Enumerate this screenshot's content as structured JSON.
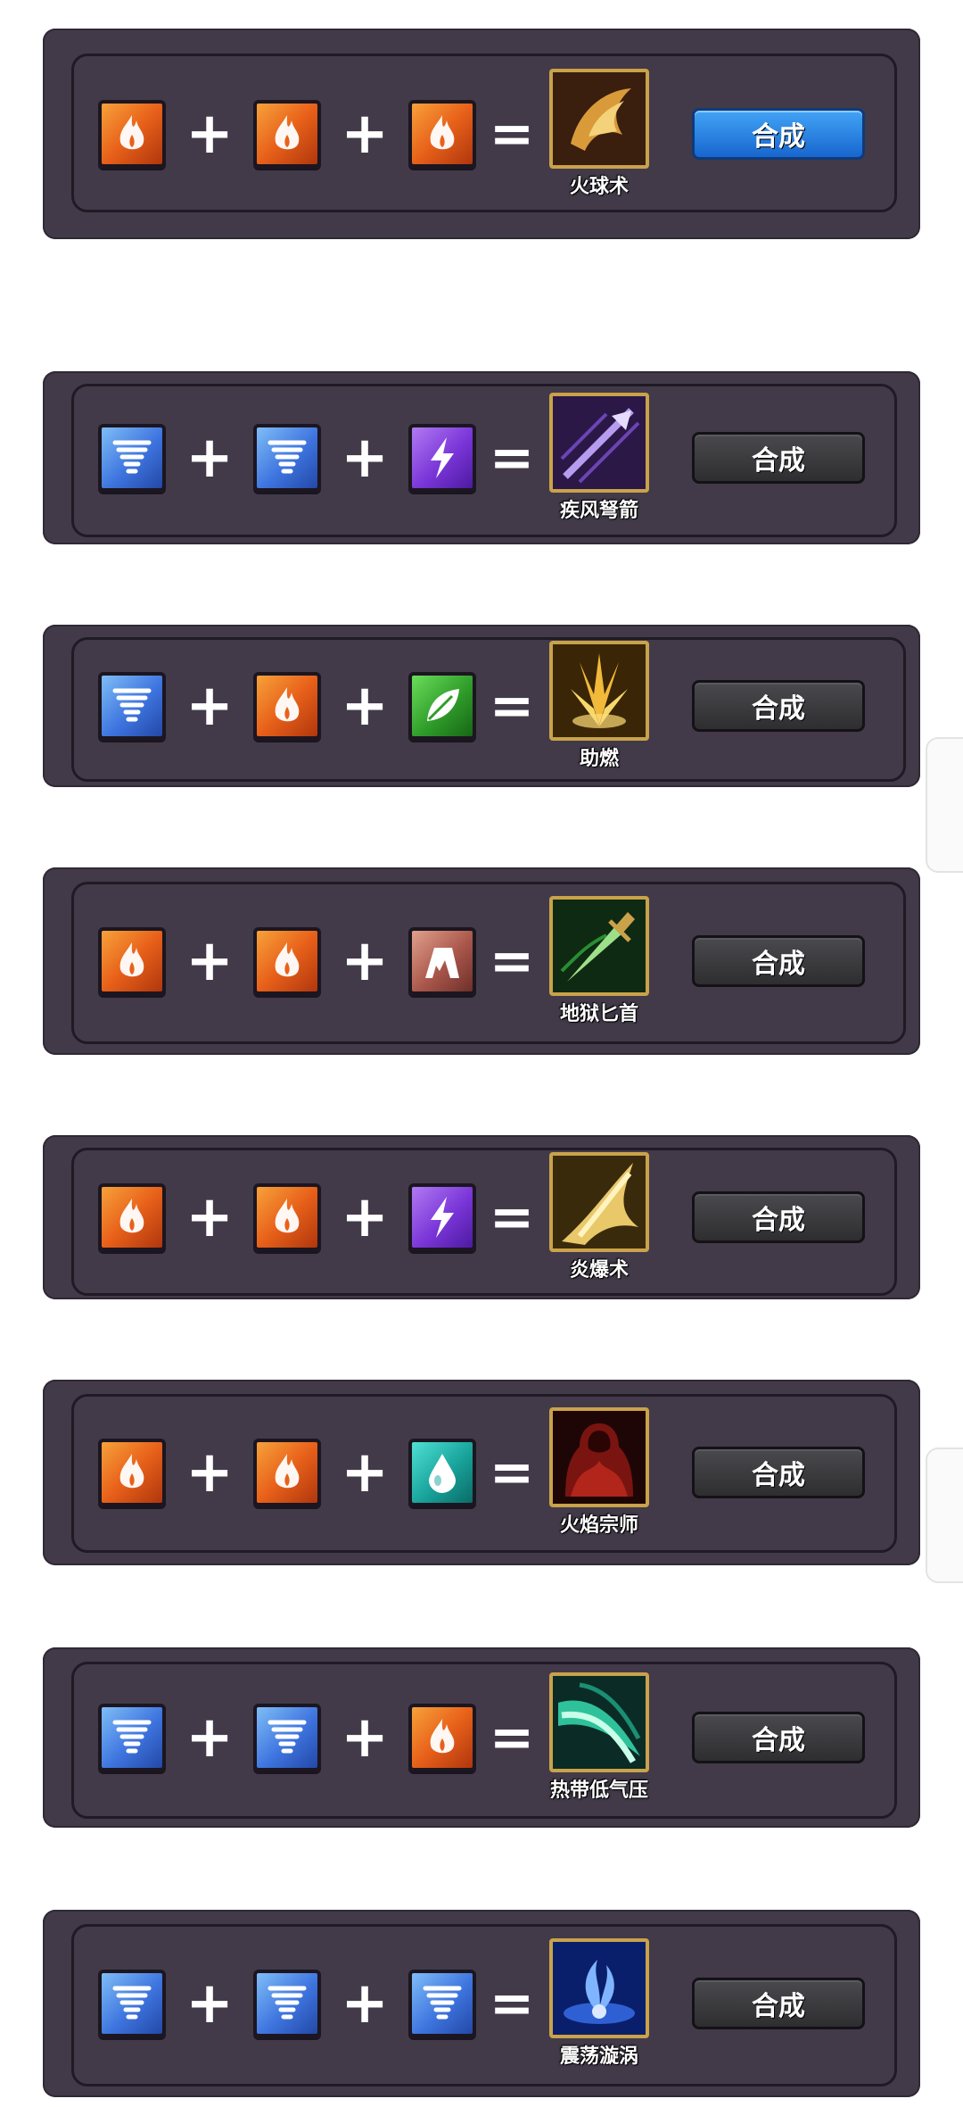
{
  "recipes": [
    {
      "ingredients": [
        "fire",
        "fire",
        "fire"
      ],
      "plus": "+",
      "equals": "=",
      "skill_name": "火球术",
      "skill_icon": "fireball-icon",
      "button_label": "合成",
      "button_active": true
    },
    {
      "ingredients": [
        "wind",
        "wind",
        "thunder"
      ],
      "plus": "+",
      "equals": "=",
      "skill_name": "疾风弩箭",
      "skill_icon": "gale-arrow-icon",
      "button_label": "合成",
      "button_active": false
    },
    {
      "ingredients": [
        "wind",
        "fire",
        "nature"
      ],
      "plus": "+",
      "equals": "=",
      "skill_name": "助燃",
      "skill_icon": "combustion-icon",
      "button_label": "合成",
      "button_active": false
    },
    {
      "ingredients": [
        "fire",
        "fire",
        "earth"
      ],
      "plus": "+",
      "equals": "=",
      "skill_name": "地狱匕首",
      "skill_icon": "hell-dagger-icon",
      "button_label": "合成",
      "button_active": false
    },
    {
      "ingredients": [
        "fire",
        "fire",
        "thunder"
      ],
      "plus": "+",
      "equals": "=",
      "skill_name": "炎爆术",
      "skill_icon": "pyroblast-icon",
      "button_label": "合成",
      "button_active": false
    },
    {
      "ingredients": [
        "fire",
        "fire",
        "water"
      ],
      "plus": "+",
      "equals": "=",
      "skill_name": "火焰宗师",
      "skill_icon": "flame-master-icon",
      "button_label": "合成",
      "button_active": false
    },
    {
      "ingredients": [
        "wind",
        "wind",
        "fire"
      ],
      "plus": "+",
      "equals": "=",
      "skill_name": "热带低气压",
      "skill_icon": "tropical-depression-icon",
      "button_label": "合成",
      "button_active": false
    },
    {
      "ingredients": [
        "wind",
        "wind",
        "wind"
      ],
      "plus": "+",
      "equals": "=",
      "skill_name": "震荡漩涡",
      "skill_icon": "shock-vortex-icon",
      "button_label": "合成",
      "button_active": false
    }
  ],
  "colors": {
    "card_bg": "#423a49",
    "button_active": "#1e7de0",
    "button_default": "#3a3a3e",
    "skill_frame": "#c9a24a"
  }
}
